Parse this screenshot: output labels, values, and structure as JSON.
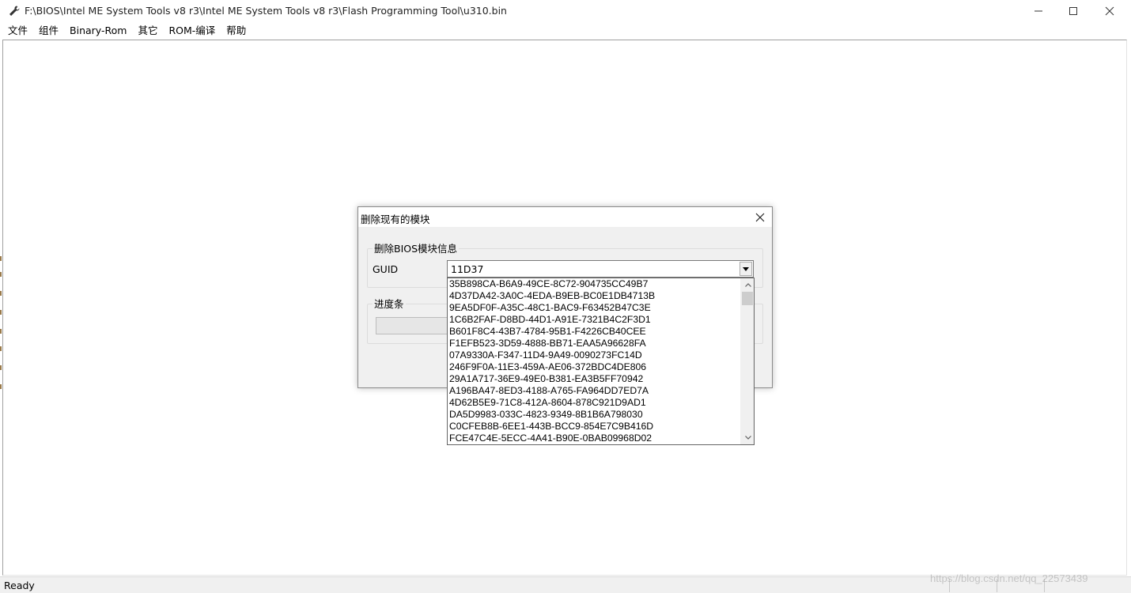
{
  "window": {
    "title": "F:\\BIOS\\Intel ME System Tools v8 r3\\Intel ME System Tools v8 r3\\Flash Programming Tool\\u310.bin"
  },
  "menu": {
    "items": [
      "文件",
      "组件",
      "Binary-Rom",
      "其它",
      "ROM-编译",
      "帮助"
    ]
  },
  "dialog": {
    "title": "删除现有的模块",
    "group_bios": "删除BIOS模块信息",
    "guid_label": "GUID",
    "guid_value": "11D37",
    "group_progress": "进度条"
  },
  "dropdown": {
    "items": [
      "35B898CA-B6A9-49CE-8C72-904735CC49B7",
      "4D37DA42-3A0C-4EDA-B9EB-BC0E1DB4713B",
      "9EA5DF0F-A35C-48C1-BAC9-F63452B47C3E",
      "1C6B2FAF-D8BD-44D1-A91E-7321B4C2F3D1",
      "B601F8C4-43B7-4784-95B1-F4226CB40CEE",
      "F1EFB523-3D59-4888-BB71-EAA5A96628FA",
      "07A9330A-F347-11D4-9A49-0090273FC14D",
      "246F9F0A-11E3-459A-AE06-372BDC4DE806",
      "29A1A717-36E9-49E0-B381-EA3B5FF70942",
      "A196BA47-8ED3-4188-A765-FA964DD7ED7A",
      "4D62B5E9-71C8-412A-8604-878C921D9AD1",
      "DA5D9983-033C-4823-9349-8B1B6A798030",
      "C0CFEB8B-6EE1-443B-BCC9-854E7C9B416D",
      "FCE47C4E-5ECC-4A41-B90E-0BAB09968D02"
    ]
  },
  "status": {
    "text": "Ready"
  },
  "watermark": "https://blog.csdn.net/qq_22573439",
  "colors": {
    "window_bg": "#ffffff",
    "dialog_bg": "#f0f0f0",
    "statusbar_bg": "#f0f0f0"
  },
  "icons": {
    "app": "wrench-icon",
    "minimize": "minimize-icon",
    "maximize": "maximize-icon",
    "close": "close-icon",
    "combo": "chevron-down-icon",
    "scroll_up": "chevron-up-icon",
    "scroll_down": "chevron-down-icon"
  }
}
